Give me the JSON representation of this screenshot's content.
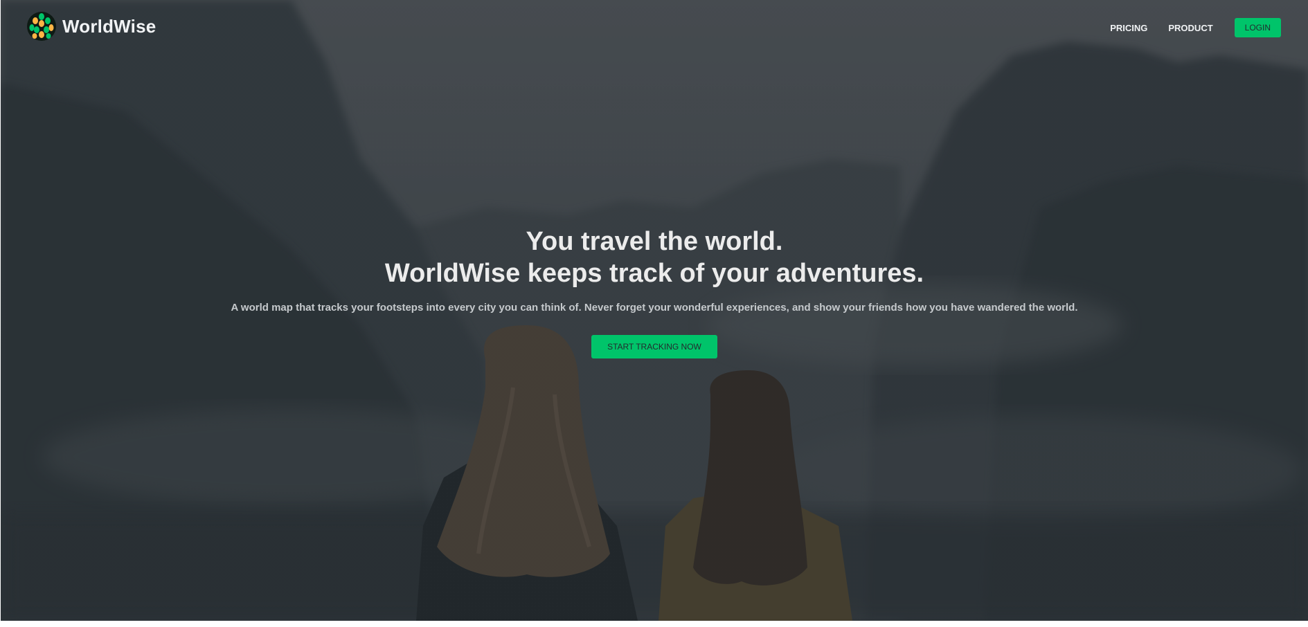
{
  "brand": {
    "name": "WorldWise",
    "logo_icon": "globe-leaf-icon",
    "accent_color": "#00c46a"
  },
  "nav": {
    "items": [
      {
        "label": "PRICING"
      },
      {
        "label": "PRODUCT"
      }
    ],
    "login_label": "LOGIN"
  },
  "hero": {
    "headline_line1": "You travel the world.",
    "headline_line2": "WorldWise keeps track of your adventures.",
    "subheadline": "A world map that tracks your footsteps into every city you can think of. Never forget your wonderful experiences, and show your friends how you have wandered the world.",
    "cta_label": "START TRACKING NOW",
    "background_image": "two-women-looking-at-mountain-valley"
  }
}
